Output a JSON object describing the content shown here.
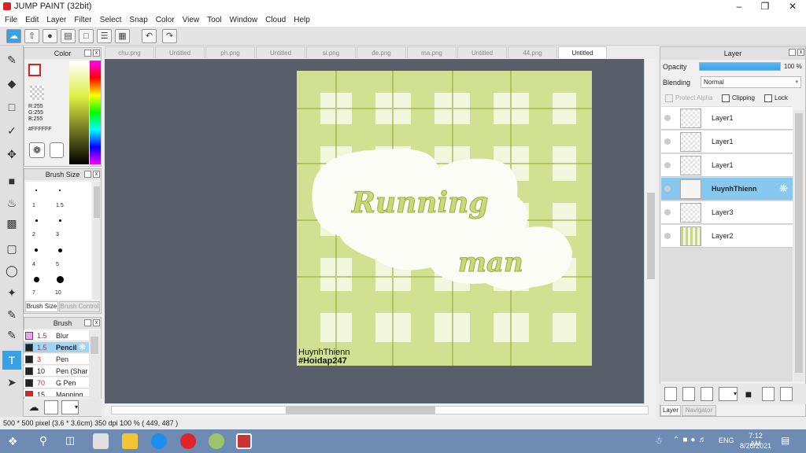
{
  "app": {
    "title": "JUMP PAINT (32bit)"
  },
  "menu": [
    "File",
    "Edit",
    "Layer",
    "Filter",
    "Select",
    "Snap",
    "Color",
    "View",
    "Tool",
    "Window",
    "Cloud",
    "Help"
  ],
  "tabs": [
    "chu.png",
    "Untitled",
    "ph.png",
    "Untitled",
    "si.png",
    "đe.png",
    "ma.png",
    "Untitled",
    "44.png",
    "Untitled"
  ],
  "color_panel": {
    "title": "Color",
    "r": "R:255",
    "g": "G:255",
    "b": "B:255",
    "hex": "#FFFFFF"
  },
  "brush_size_panel": {
    "title": "Brush Size",
    "sizes": [
      "1",
      "1.5",
      "2",
      "3",
      "4",
      "5",
      "7",
      "10"
    ],
    "tab1": "Brush Size",
    "tab2": "Brush Control"
  },
  "brush_panel": {
    "title": "Brush",
    "items": [
      {
        "size": "1.5",
        "name": "Blur",
        "color": "#f0a0f0"
      },
      {
        "size": "1.5",
        "name": "Pencil",
        "color": "#222222"
      },
      {
        "size": "3",
        "name": "Pen",
        "color": "#222222"
      },
      {
        "size": "10",
        "name": "Pen (Shar",
        "color": "#222222"
      },
      {
        "size": "70",
        "name": "G Pen",
        "color": "#222222"
      },
      {
        "size": "15",
        "name": "Mapping P",
        "color": "#d22222"
      }
    ]
  },
  "layer_panel": {
    "title": "Layer",
    "opacity_label": "Opacity",
    "opacity_value": "100 %",
    "blending_label": "Blending",
    "blending_value": "Normal",
    "protect_alpha": "Protect Alpha",
    "clipping": "Clipping",
    "lock": "Lock",
    "layers": [
      "Layer1",
      "Layer1",
      "Layer1",
      "HuynhThienn",
      "Layer3",
      "Layer2"
    ],
    "tab_layer": "Layer",
    "tab_navigator": "Navigator"
  },
  "artwork": {
    "title_top": "Running",
    "title_bottom": "man",
    "credit1": "HuynhThienn",
    "credit2": "#Hoidap247"
  },
  "status": {
    "text": "500 * 500 pixel  (3.6 * 3.6cm)  350 dpi  100 %  ( 449, 487 )"
  },
  "taskbar": {
    "lang": "ENG",
    "time": "7:12 AM",
    "date": "8/28/2021"
  },
  "colors": {
    "accent": "#3aa2e4",
    "canvas_bg": "#585f6b",
    "plaid": "#c8d97a"
  }
}
